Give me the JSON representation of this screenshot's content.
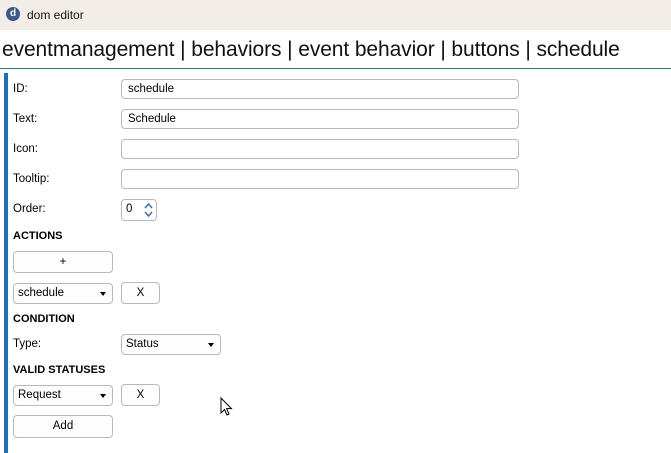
{
  "window": {
    "title": "dom editor",
    "logo_letter": "d"
  },
  "breadcrumb": "eventmanagement | behaviors | event behavior | buttons | schedule",
  "fields": {
    "id": {
      "label": "ID:",
      "value": "schedule"
    },
    "text": {
      "label": "Text:",
      "value": "Schedule"
    },
    "icon": {
      "label": "Icon:",
      "value": ""
    },
    "tooltip": {
      "label": "Tooltip:",
      "value": ""
    },
    "order": {
      "label": "Order:",
      "value": "0"
    }
  },
  "actions": {
    "heading": "ACTIONS",
    "add_label": "+",
    "items": [
      {
        "selected": "schedule",
        "remove_label": "X"
      }
    ]
  },
  "condition": {
    "heading": "CONDITION",
    "type_label": "Type:",
    "type_value": "Status"
  },
  "valid_statuses": {
    "heading": "VALID STATUSES",
    "items": [
      {
        "selected": "Request",
        "remove_label": "X"
      }
    ],
    "add_label": "Add"
  },
  "colors": {
    "accent_bar": "#1e6fb8",
    "header_line": "#2a7a7a",
    "titlebar_bg": "#f3ede7"
  }
}
